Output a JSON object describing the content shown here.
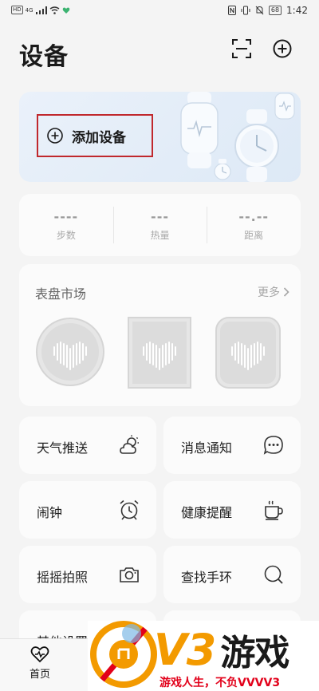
{
  "status_bar": {
    "left_indicators": [
      "HD",
      "4G",
      "signal",
      "wifi",
      "health"
    ],
    "hd_badge": "HD",
    "network": "4G",
    "battery": "68",
    "time": "1:42"
  },
  "header": {
    "title": "设备",
    "scan_icon": "scan-icon",
    "add_icon": "plus-circle-icon"
  },
  "add_device": {
    "label": "添加设备",
    "icon": "plus-circle-icon",
    "illustration": "smartwatch-illustration"
  },
  "stats": [
    {
      "value": "----",
      "label": "步数"
    },
    {
      "value": "---",
      "label": "热量"
    },
    {
      "value": "--.--",
      "label": "距离"
    }
  ],
  "market": {
    "title": "表盘市场",
    "more": "更多",
    "faces": [
      {
        "shape": "round",
        "icon": "heart-rate-icon"
      },
      {
        "shape": "square",
        "icon": "heart-rate-icon"
      },
      {
        "shape": "rounded-square",
        "icon": "heart-rate-icon"
      }
    ]
  },
  "features": [
    {
      "label": "天气推送",
      "icon": "weather-icon"
    },
    {
      "label": "消息通知",
      "icon": "message-icon"
    },
    {
      "label": "闹钟",
      "icon": "alarm-icon"
    },
    {
      "label": "健康提醒",
      "icon": "cup-icon"
    },
    {
      "label": "摇摇拍照",
      "icon": "camera-icon"
    },
    {
      "label": "查找手环",
      "icon": "search-icon"
    },
    {
      "label": "其他设置",
      "icon": "settings-icon"
    }
  ],
  "bottom_nav": {
    "home_label": "首页",
    "home_icon": "heart-pulse-icon"
  },
  "watermark": {
    "logo": "V3",
    "logo_cn": "游戏",
    "slogan": "游戏人生，不负VVVV3"
  },
  "colors": {
    "accent_red": "#c0282d",
    "watermark_orange": "#f39a00",
    "watermark_red": "#e2001a"
  }
}
